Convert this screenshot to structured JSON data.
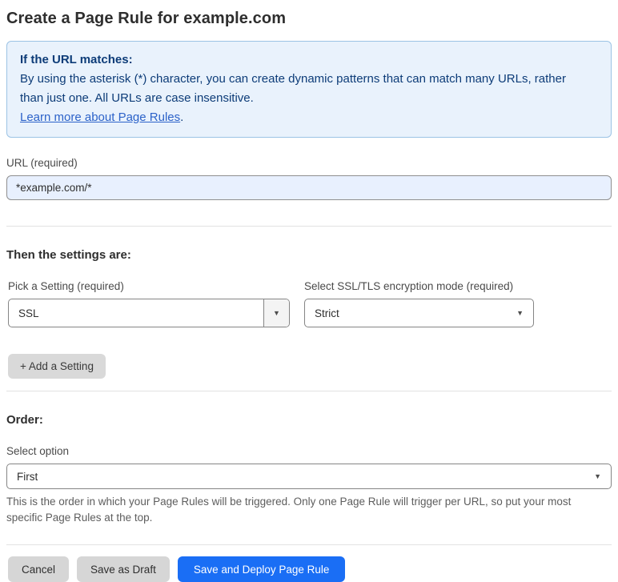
{
  "page": {
    "title": "Create a Page Rule for example.com"
  },
  "info_box": {
    "heading": "If the URL matches:",
    "body": "By using the asterisk (*) character, you can create dynamic patterns that can match many URLs, rather than just one. All URLs are case insensitive.",
    "link_label": "Learn more about Page Rules",
    "link_suffix": "."
  },
  "url_field": {
    "label": "URL (required)",
    "value": "*example.com/*"
  },
  "settings_section": {
    "heading": "Then the settings are:",
    "setting_picker": {
      "label": "Pick a Setting (required)",
      "value": "SSL"
    },
    "ssl_mode_picker": {
      "label": "Select SSL/TLS encryption mode (required)",
      "value": "Strict"
    },
    "add_setting_label": "+ Add a Setting"
  },
  "order_section": {
    "heading": "Order:",
    "select_label": "Select option",
    "value": "First",
    "help_text": "This is the order in which your Page Rules will be triggered. Only one Page Rule will trigger per URL, so put your most specific Page Rules at the top."
  },
  "footer": {
    "cancel_label": "Cancel",
    "save_draft_label": "Save as Draft",
    "save_deploy_label": "Save and Deploy Page Rule"
  },
  "icons": {
    "dropdown_caret": "▼"
  },
  "colors": {
    "accent_blue": "#1a6ef5",
    "info_bg": "#e9f2fc",
    "info_border": "#9cc3e5",
    "info_text": "#0d3c78",
    "link_blue": "#2c62c9",
    "autofill_input_bg": "#e8f0fe",
    "gray_button_bg": "#d6d6d6"
  }
}
